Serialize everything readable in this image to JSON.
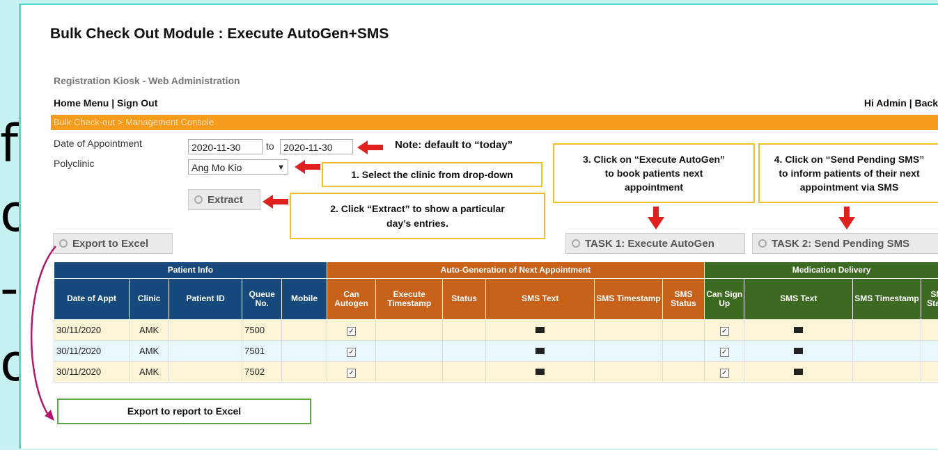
{
  "left_glyphs": [
    "f",
    "o",
    "-",
    "o"
  ],
  "page": {
    "title": "Bulk Check Out Module : Execute AutoGen+SMS"
  },
  "app": {
    "header": "Registration Kiosk - Web Administration",
    "home_menu": "Home Menu",
    "sign_out": "Sign Out",
    "nav_separator": "|",
    "greeting": "Hi Admin | Back",
    "breadcrumb": "Bulk Check-out > Management Console"
  },
  "form": {
    "date_label": "Date of Appointment",
    "date_from": "2020-11-30",
    "date_to_word": "to",
    "date_to": "2020-11-30",
    "polyclinic_label": "Polyclinic",
    "polyclinic_value": "Ang Mo Kio",
    "extract_button": "Extract",
    "export_button": "Export to Excel",
    "task1_button": "TASK 1: Execute AutoGen",
    "task2_button": "TASK 2: Send Pending SMS"
  },
  "annotations": {
    "note_default": "Note: default to “today”",
    "step1": "1. Select the clinic from drop-down",
    "step2_line1": "2. Click “Extract” to show a particular",
    "step2_line2": "day’s entries.",
    "step3_line1": "3. Click on “Execute AutoGen”",
    "step3_line2": "to book patients next",
    "step3_line3": "appointment",
    "step4_line1": "4. Click on “Send Pending SMS”",
    "step4_line2": "to inform patients of their next",
    "step4_line3": "appointment via SMS",
    "export_note": "Export to report to Excel"
  },
  "colors": {
    "patient_group": "#174a7c",
    "autogen_group": "#c8611a",
    "medication_group": "#3d6a21",
    "orange_bar": "#f79b1d",
    "arrow_red": "#e0201c"
  },
  "table": {
    "groups": {
      "patient": "Patient Info",
      "autogen": "Auto-Generation of Next Appointment",
      "medication": "Medication Delivery"
    },
    "headers": {
      "date": "Date of Appt",
      "clinic": "Clinic",
      "patient_id": "Patient ID",
      "queue": "Queue No.",
      "mobile": "Mobile",
      "can_autogen": "Can Autogen",
      "exec_ts": "Execute Timestamp",
      "status": "Status",
      "sms_text": "SMS Text",
      "sms_ts": "SMS Timestamp",
      "sms_status": "SMS Status",
      "can_signup": "Can Sign Up",
      "med_sms_text": "SMS Text",
      "med_sms_ts": "SMS Timestamp",
      "med_sms_status": "SMS Status"
    },
    "rows": [
      {
        "date": "30/11/2020",
        "clinic": "AMK",
        "queue": "7500",
        "can_autogen": "✓",
        "can_signup": "✓"
      },
      {
        "date": "30/11/2020",
        "clinic": "AMK",
        "queue": "7501",
        "can_autogen": "✓",
        "can_signup": "✓"
      },
      {
        "date": "30/11/2020",
        "clinic": "AMK",
        "queue": "7502",
        "can_autogen": "✓",
        "can_signup": "✓"
      }
    ]
  }
}
